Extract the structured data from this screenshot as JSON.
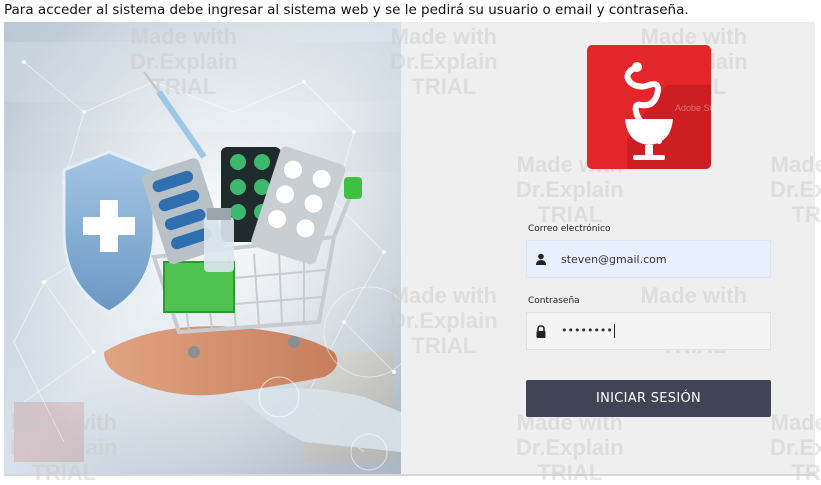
{
  "caption": "Para acceder al sistema debe ingresar al sistema web y se le pedirá su usuario o email y contraseña.",
  "login": {
    "email_label": "Correo electrónico",
    "email_value": "steven@gmail.com",
    "password_label": "Contraseña",
    "password_mask": "••••••••",
    "submit_label": "INICIAR SESIÓN"
  },
  "logo": {
    "icon": "pharmacy-caduceus-icon",
    "bg_color": "#e3262a",
    "watermark_text": "Adobe Stock"
  },
  "hero_image": {
    "description_icon": "pharmacy-shopping-cart-icon",
    "shield_icon": "medical-cross-shield-icon"
  },
  "watermark": {
    "line1": "Made with",
    "line2": "Dr.Explain",
    "line3": "TRIAL"
  },
  "colors": {
    "button_bg": "#414455",
    "email_bg": "#e8f0fe",
    "logo_red": "#e3262a"
  }
}
